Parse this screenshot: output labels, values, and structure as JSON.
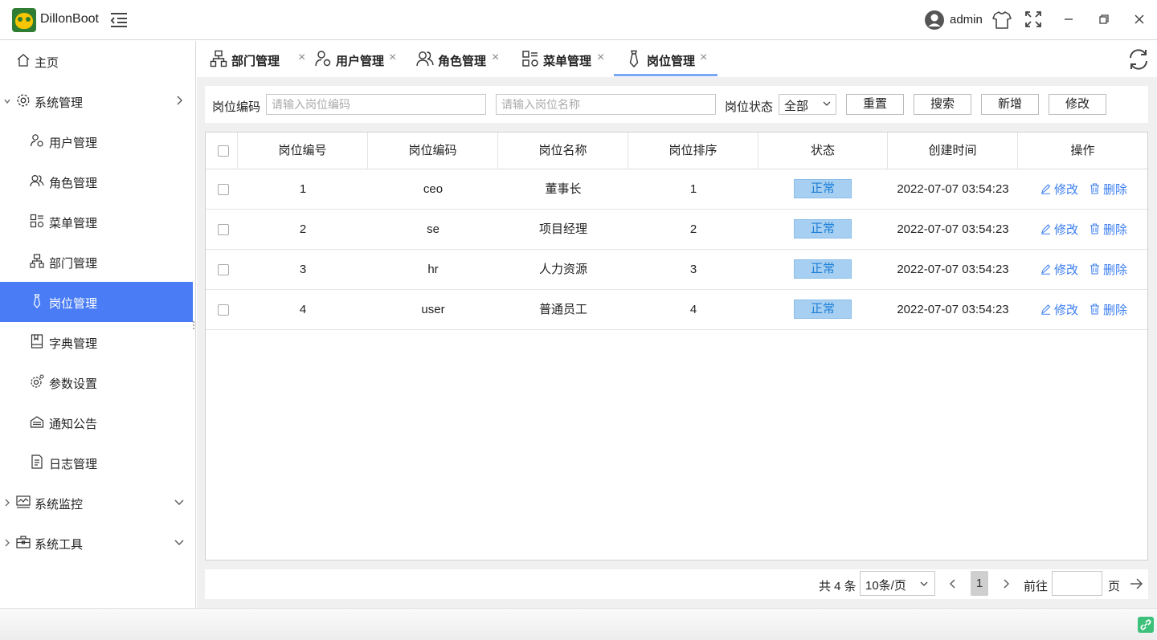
{
  "app": {
    "name": "DillonBoot",
    "user": "admin"
  },
  "sidebar": {
    "items": [
      {
        "label": "主页",
        "icon": "home-icon"
      },
      {
        "label": "系统管理",
        "icon": "gear-icon"
      },
      {
        "label": "用户管理",
        "icon": "user-gear-icon"
      },
      {
        "label": "角色管理",
        "icon": "users-icon"
      },
      {
        "label": "菜单管理",
        "icon": "menu-grid-icon"
      },
      {
        "label": "部门管理",
        "icon": "org-chart-icon"
      },
      {
        "label": "岗位管理",
        "icon": "tie-icon",
        "active": true
      },
      {
        "label": "字典管理",
        "icon": "book-icon"
      },
      {
        "label": "参数设置",
        "icon": "settings-icon"
      },
      {
        "label": "通知公告",
        "icon": "notice-icon"
      },
      {
        "label": "日志管理",
        "icon": "log-file-icon"
      },
      {
        "label": "系统监控",
        "icon": "monitor-icon"
      },
      {
        "label": "系统工具",
        "icon": "toolbox-icon"
      }
    ]
  },
  "tabs": [
    {
      "label": "部门管理",
      "icon": "org-chart-icon"
    },
    {
      "label": "用户管理",
      "icon": "user-gear-icon"
    },
    {
      "label": "角色管理",
      "icon": "users-icon"
    },
    {
      "label": "菜单管理",
      "icon": "menu-grid-icon"
    },
    {
      "label": "岗位管理",
      "icon": "tie-icon",
      "active": true
    }
  ],
  "search": {
    "code_label": "岗位编码",
    "code_placeholder": "请输入岗位编码",
    "name_placeholder": "请输入岗位名称",
    "status_label": "岗位状态",
    "status_value": "全部",
    "reset": "重置",
    "search": "搜索",
    "add": "新增",
    "edit": "修改"
  },
  "table": {
    "headers": [
      "岗位编号",
      "岗位编码",
      "岗位名称",
      "岗位排序",
      "状态",
      "创建时间",
      "操作"
    ],
    "rows": [
      {
        "id": "1",
        "code": "ceo",
        "name": "董事长",
        "sort": "1",
        "status": "正常",
        "created": "2022-07-07 03:54:23"
      },
      {
        "id": "2",
        "code": "se",
        "name": "项目经理",
        "sort": "2",
        "status": "正常",
        "created": "2022-07-07 03:54:23"
      },
      {
        "id": "3",
        "code": "hr",
        "name": "人力资源",
        "sort": "3",
        "status": "正常",
        "created": "2022-07-07 03:54:23"
      },
      {
        "id": "4",
        "code": "user",
        "name": "普通员工",
        "sort": "4",
        "status": "正常",
        "created": "2022-07-07 03:54:23"
      }
    ],
    "edit_label": "修改",
    "delete_label": "删除"
  },
  "pagination": {
    "total": "共 4 条",
    "page_size": "10条/页",
    "current": "1",
    "goto": "前往",
    "unit": "页"
  },
  "colors": {
    "accent": "#4a7cf5",
    "link": "#3a7df0",
    "status_bg": "#a6cff2"
  }
}
